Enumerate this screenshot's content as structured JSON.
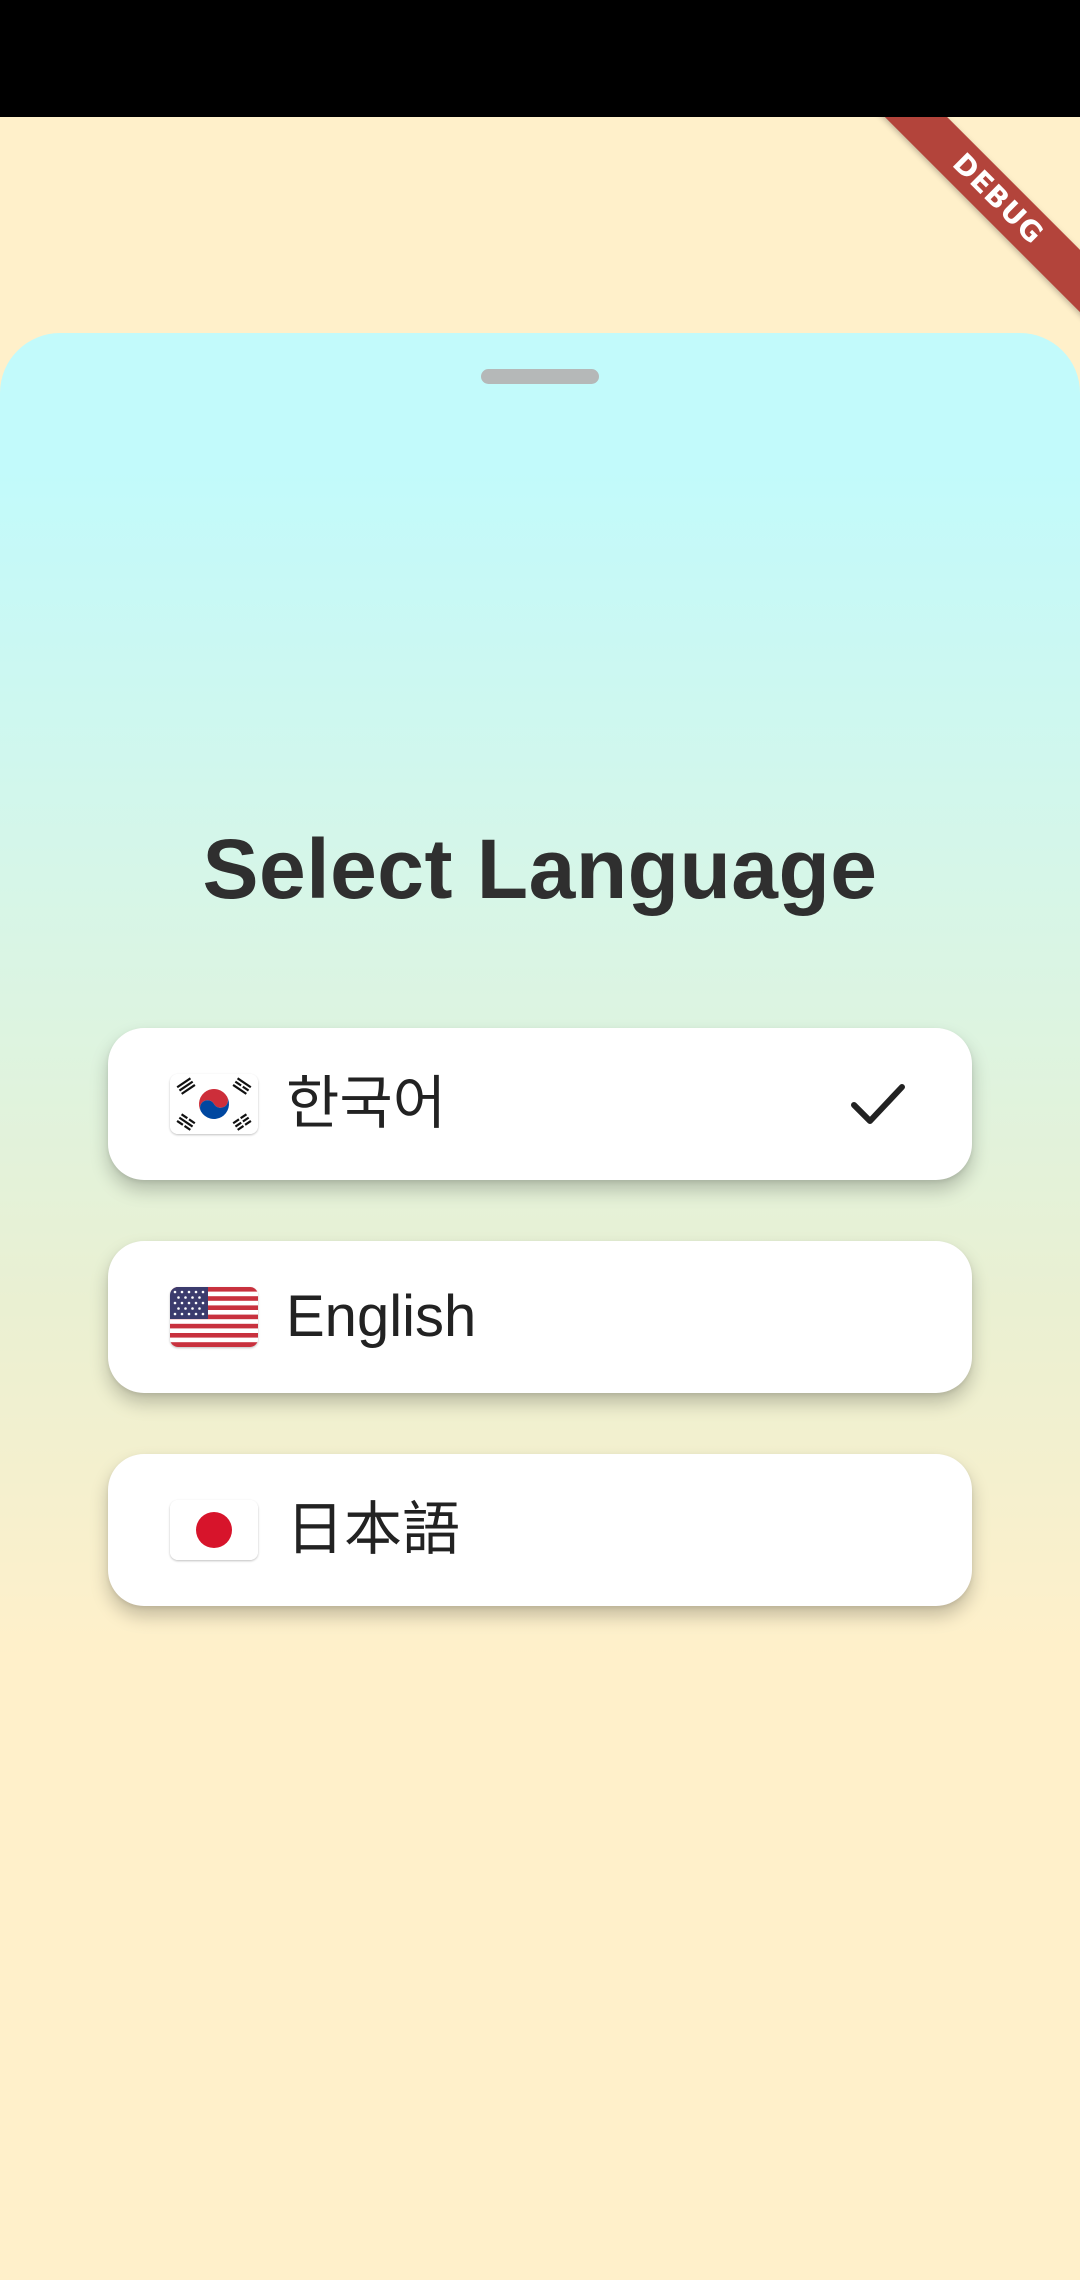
{
  "debug_banner": {
    "label": "DEBUG"
  },
  "sheet": {
    "title": "Select Language",
    "languages": [
      {
        "label": "한국어",
        "flag": "south-korea-flag",
        "selected": true
      },
      {
        "label": "English",
        "flag": "usa-flag",
        "selected": false
      },
      {
        "label": "日本語",
        "flag": "japan-flag",
        "selected": false
      }
    ]
  },
  "colors": {
    "background": "#fff0ca",
    "sheet_top": "#c2fafb",
    "card": "#ffffff",
    "title": "#2f2f2f",
    "debug_banner": "#b3443b"
  }
}
